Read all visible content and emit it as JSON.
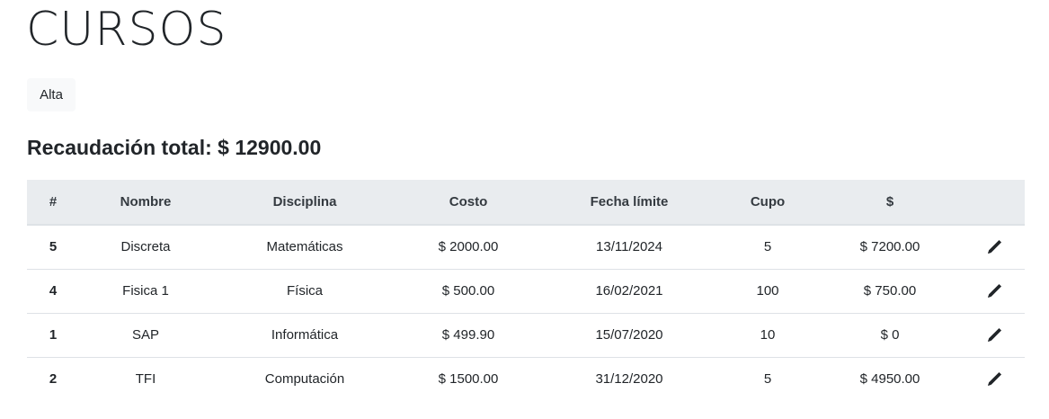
{
  "page": {
    "title": "CURSOS",
    "add_button_label": "Alta",
    "total_label": "Recaudación total: $ 12900.00"
  },
  "table": {
    "headers": [
      "#",
      "Nombre",
      "Disciplina",
      "Costo",
      "Fecha límite",
      "Cupo",
      "$",
      ""
    ],
    "rows": [
      {
        "id": "5",
        "nombre": "Discreta",
        "disciplina": "Matemáticas",
        "costo": "$ 2000.00",
        "fecha": "13/11/2024",
        "cupo": "5",
        "total": "$ 7200.00",
        "action_icon": "pencil-icon"
      },
      {
        "id": "4",
        "nombre": "Fisica 1",
        "disciplina": "Física",
        "costo": "$ 500.00",
        "fecha": "16/02/2021",
        "cupo": "100",
        "total": "$ 750.00",
        "action_icon": "pencil-icon"
      },
      {
        "id": "1",
        "nombre": "SAP",
        "disciplina": "Informática",
        "costo": "$ 499.90",
        "fecha": "15/07/2020",
        "cupo": "10",
        "total": "$ 0",
        "action_icon": "pencil-icon"
      },
      {
        "id": "2",
        "nombre": "TFI",
        "disciplina": "Computación",
        "costo": "$ 1500.00",
        "fecha": "31/12/2020",
        "cupo": "5",
        "total": "$ 4950.00",
        "action_icon": "pencil-icon"
      }
    ]
  },
  "colors": {
    "header_bg": "#e9ecef",
    "button_bg": "#f8f9fa",
    "text": "#212529",
    "divider": "#dee2e6"
  }
}
